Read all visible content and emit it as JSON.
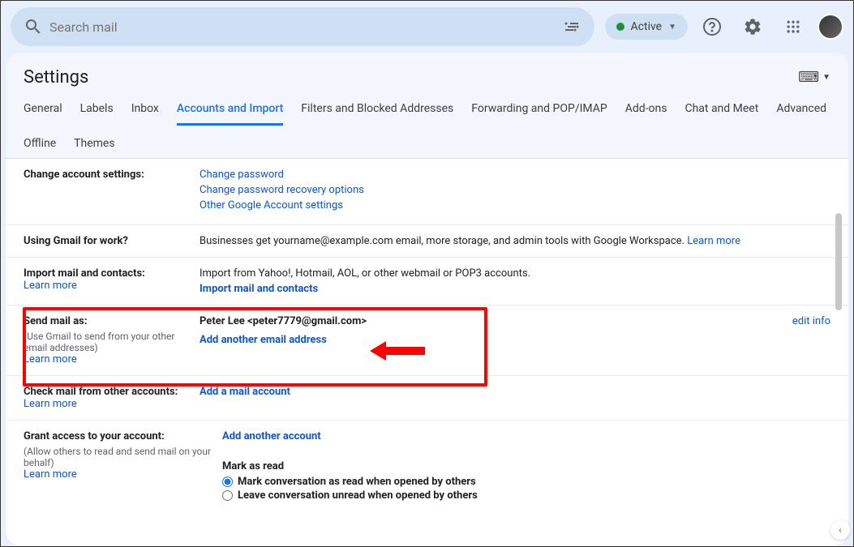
{
  "search": {
    "placeholder": "Search mail"
  },
  "status": {
    "label": "Active"
  },
  "pageTitle": "Settings",
  "tabs": [
    "General",
    "Labels",
    "Inbox",
    "Accounts and Import",
    "Filters and Blocked Addresses",
    "Forwarding and POP/IMAP",
    "Add-ons",
    "Chat and Meet",
    "Advanced",
    "Offline",
    "Themes"
  ],
  "sections": {
    "changeAccount": {
      "title": "Change account settings:",
      "links": [
        "Change password",
        "Change password recovery options",
        "Other Google Account settings"
      ]
    },
    "work": {
      "title": "Using Gmail for work?",
      "text": "Businesses get yourname@example.com email, more storage, and admin tools with Google Workspace.",
      "learnMore": "Learn more"
    },
    "import": {
      "title": "Import mail and contacts:",
      "learnMore": "Learn more",
      "text": "Import from Yahoo!, Hotmail, AOL, or other webmail or POP3 accounts.",
      "action": "Import mail and contacts"
    },
    "sendAs": {
      "title": "Send mail as:",
      "sub": "(Use Gmail to send from your other email addresses)",
      "learnMore": "Learn more",
      "identity": "Peter Lee <peter7779@gmail.com>",
      "action": "Add another email address",
      "editInfo": "edit info"
    },
    "checkMail": {
      "title": "Check mail from other accounts:",
      "learnMore": "Learn more",
      "action": "Add a mail account"
    },
    "grant": {
      "title": "Grant access to your account:",
      "sub": "(Allow others to read and send mail on your behalf)",
      "learnMore": "Learn more",
      "action": "Add another account",
      "markAsRead": "Mark as read",
      "opt1": "Mark conversation as read when opened by others",
      "opt2": "Leave conversation unread when opened by others"
    }
  }
}
